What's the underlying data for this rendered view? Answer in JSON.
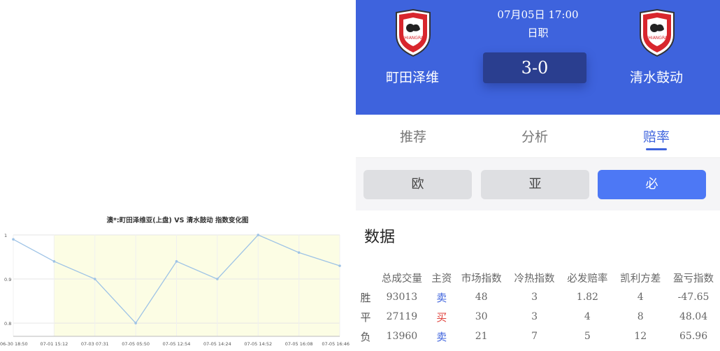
{
  "colors": {
    "header_bg": "#3e63dd",
    "accent": "#3e63dd",
    "sell": "#3e63dd",
    "buy": "#e0413b",
    "active_subtab": "#4d78f5"
  },
  "chart_data": {
    "type": "line",
    "title": "澳*:町田泽维亚(上盘) VS 清水鼓动 指数变化图",
    "categories": [
      "06-30 18:50",
      "07-01 15:12",
      "07-03 07:31",
      "07-05 05:50",
      "07-05 12:54",
      "07-05 14:24",
      "07-05 14:52",
      "07-05 16:08",
      "07-05 16:46"
    ],
    "values": [
      0.99,
      0.94,
      0.9,
      0.8,
      0.94,
      0.9,
      1.0,
      0.96,
      0.93
    ],
    "y_ticks": [
      "0.8",
      "0.9",
      "1"
    ],
    "ylim": [
      0.77,
      1.0
    ],
    "highlight_from_index": 1,
    "line_color": "#9ec3e6",
    "highlight_color": "#fcfde4",
    "grid": true
  },
  "match": {
    "date": "07月05日 17:00",
    "league": "日职",
    "score": "3-0",
    "home": {
      "name": "町田泽维",
      "logo_icon": "team-crest-icon"
    },
    "away": {
      "name": "清水鼓动",
      "logo_icon": "team-crest-icon"
    }
  },
  "tabs": {
    "recommend": "推荐",
    "analysis": "分析",
    "odds": "赔率",
    "active": "odds"
  },
  "subtabs": {
    "eu": "欧",
    "asia": "亚",
    "bi": "必",
    "active": "bi"
  },
  "data": {
    "title": "数据",
    "headers": [
      "总成交量",
      "主资",
      "市场指数",
      "冷热指数",
      "必发赔率",
      "凯利方差",
      "盈亏指数"
    ],
    "rows": [
      {
        "label": "胜",
        "volume": "93013",
        "side": "卖",
        "side_type": "sell",
        "market": "48",
        "hot": "3",
        "odds": "1.82",
        "kelly": "4",
        "pnl": "-47.65"
      },
      {
        "label": "平",
        "volume": "27119",
        "side": "买",
        "side_type": "buy",
        "market": "30",
        "hot": "3",
        "odds": "4",
        "kelly": "8",
        "pnl": "48.04"
      },
      {
        "label": "负",
        "volume": "13960",
        "side": "卖",
        "side_type": "sell",
        "market": "21",
        "hot": "7",
        "odds": "5",
        "kelly": "12",
        "pnl": "65.96"
      }
    ]
  }
}
